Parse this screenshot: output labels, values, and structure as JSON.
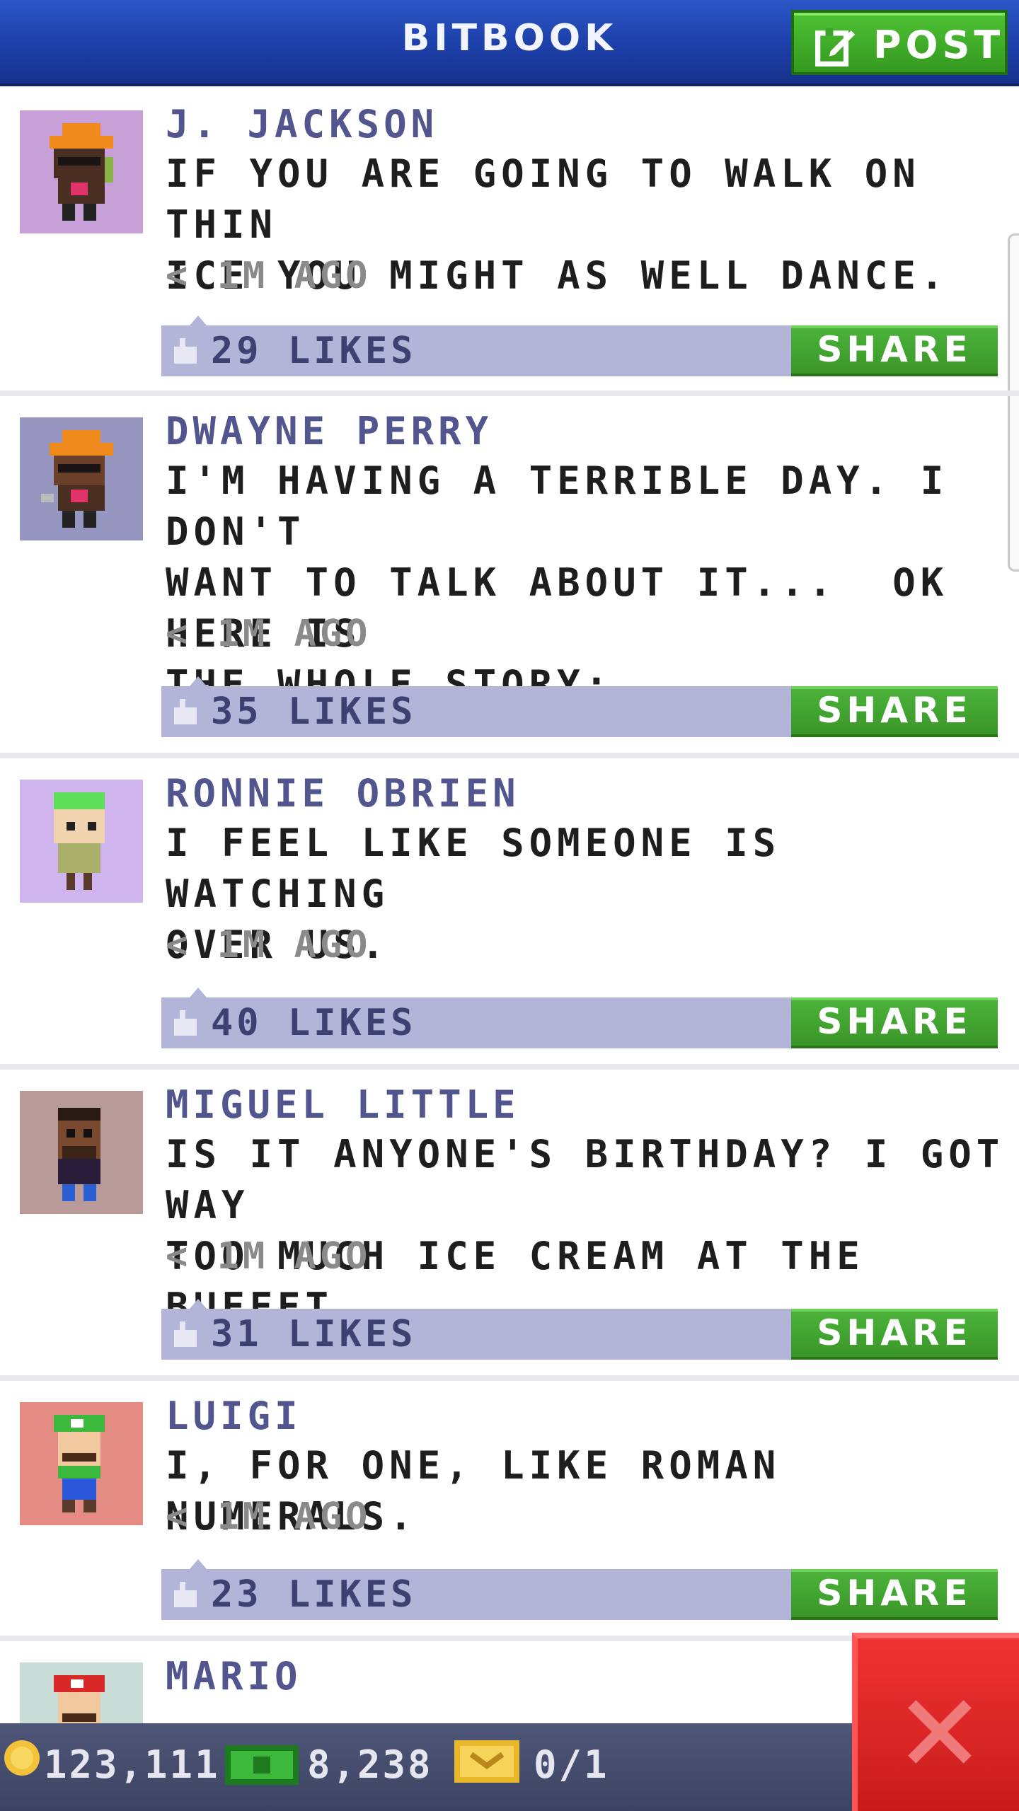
{
  "app": {
    "title": "BITBOOK",
    "post_button_label": "POST",
    "icons": {
      "post": "compose-icon",
      "close": "close-icon",
      "like": "thumb-icon"
    }
  },
  "posts": [
    {
      "author": "J. JACKSON",
      "body": "IF YOU ARE GOING TO WALK ON THIN\nICE YOU MIGHT AS WELL DANCE.",
      "time": "< 1M AGO",
      "likes": "29 LIKES",
      "share": "SHARE",
      "avatar_bg": "#c8a0d8"
    },
    {
      "author": "DWAYNE PERRY",
      "body": "I'M HAVING A TERRIBLE DAY. I DON'T\nWANT TO TALK ABOUT IT...  OK HERE IS\nTHE WHOLE STORY:",
      "time": "< 1M AGO",
      "likes": "35 LIKES",
      "share": "SHARE",
      "avatar_bg": "#9696c0"
    },
    {
      "author": "RONNIE OBRIEN",
      "body": "I FEEL LIKE SOMEONE IS WATCHING\nOVER US.",
      "time": "< 1M AGO",
      "likes": "40 LIKES",
      "share": "SHARE",
      "avatar_bg": "#d0b4ee"
    },
    {
      "author": "MIGUEL LITTLE",
      "body": "IS IT ANYONE'S BIRTHDAY? I GOT WAY\nTOO MUCH ICE CREAM AT THE BUFFET.",
      "time": "< 1M AGO",
      "likes": "31 LIKES",
      "share": "SHARE",
      "avatar_bg": "#b89a98"
    },
    {
      "author": "LUIGI",
      "body": "I, FOR ONE, LIKE ROMAN NUMERALS.",
      "time": "< 1M AGO",
      "likes": "23 LIKES",
      "share": "SHARE",
      "avatar_bg": "#e48c84"
    },
    {
      "author": "MARIO",
      "body": "",
      "time": "",
      "likes": "",
      "share": "",
      "avatar_bg": "#c8dcd8"
    }
  ],
  "status_bar": {
    "coins": "123,111",
    "bux": "8,238",
    "tickets": "0/1"
  },
  "colors": {
    "header": "#1c3fa8",
    "author": "#53558f",
    "likes_bar": "#b2b5d8",
    "share": "#3a9629",
    "close": "#e02828"
  }
}
